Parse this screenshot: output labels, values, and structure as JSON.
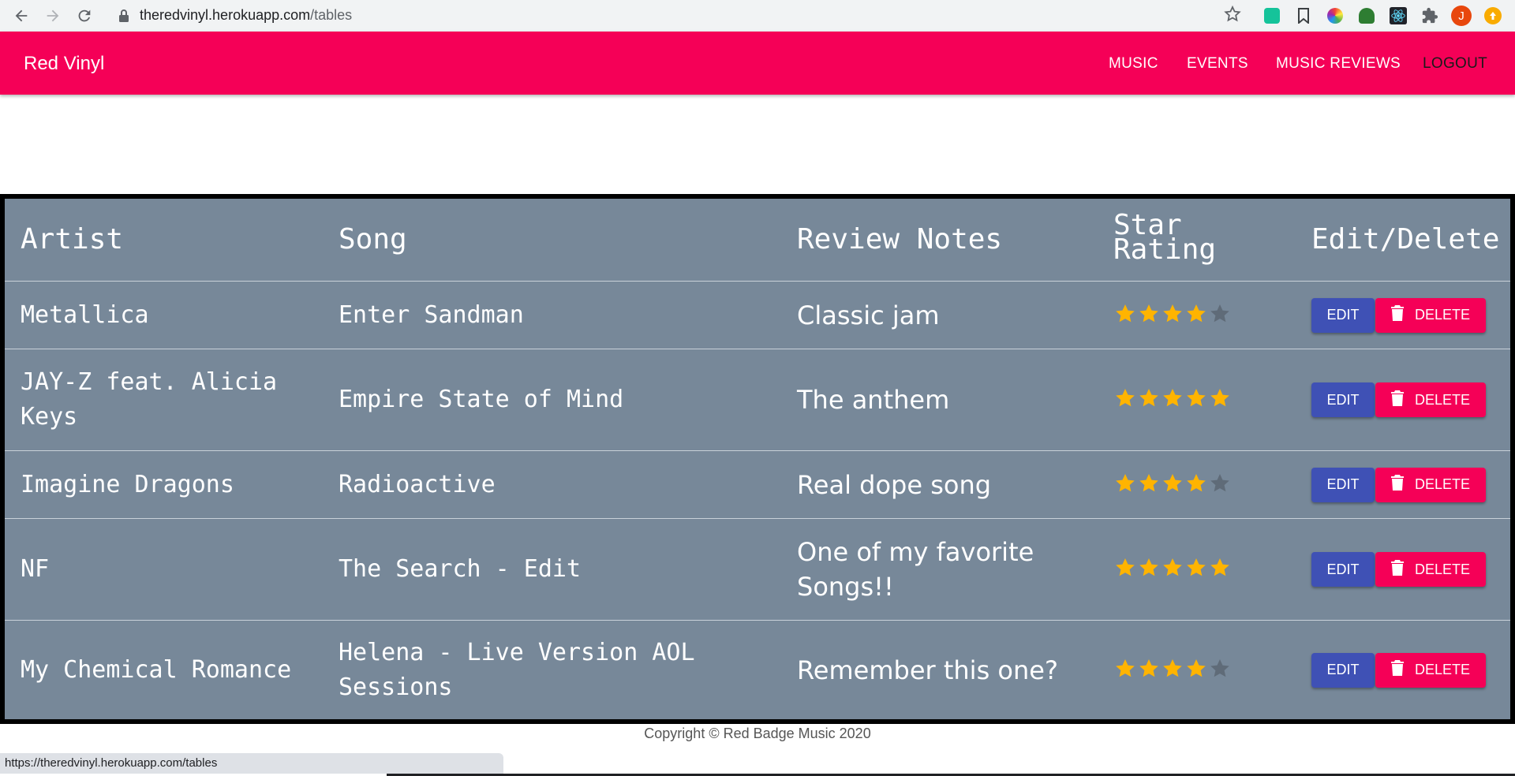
{
  "browser": {
    "url_host": "theredvinyl.herokuapp.com",
    "url_path": "/tables",
    "status_url": "https://theredvinyl.herokuapp.com/tables",
    "profile_initial": "J"
  },
  "appbar": {
    "brand": "Red Vinyl",
    "nav": {
      "music": "MUSIC",
      "events": "EVENTS",
      "reviews": "MUSIC REVIEWS",
      "logout": "LOGOUT"
    },
    "color": "#f50057"
  },
  "table": {
    "headers": {
      "artist": "Artist",
      "song": "Song",
      "notes": "Review Notes",
      "rating_line1": "Star",
      "rating_line2": "Rating",
      "actions": "Edit/Delete"
    },
    "rows": [
      {
        "artist_1": "Metallica",
        "artist_2": "",
        "song_1": "Enter Sandman",
        "song_2": "",
        "notes_1": "Classic jam",
        "notes_2": "",
        "rating": 4
      },
      {
        "artist_1": "JAY-Z feat. Alicia",
        "artist_2": "Keys",
        "song_1": "Empire State of Mind",
        "song_2": "",
        "notes_1": "The anthem",
        "notes_2": "",
        "rating": 5
      },
      {
        "artist_1": "Imagine Dragons",
        "artist_2": "",
        "song_1": "Radioactive",
        "song_2": "",
        "notes_1": "Real dope song",
        "notes_2": "",
        "rating": 4
      },
      {
        "artist_1": "NF",
        "artist_2": "",
        "song_1": "The Search - Edit",
        "song_2": "",
        "notes_1": "One of my favorite",
        "notes_2": "Songs!!",
        "rating": 5
      },
      {
        "artist_1": "My Chemical Romance",
        "artist_2": "",
        "song_1": "Helena - Live Version AOL",
        "song_2": "Sessions",
        "notes_1": "Remember this one?",
        "notes_2": "",
        "rating": 4
      }
    ],
    "max_rating": 5,
    "edit_label": "EDIT",
    "delete_label": "DELETE",
    "star_on_color": "#ffb400",
    "star_off_color": "#5f6b78"
  },
  "footer": {
    "copyright": "Copyright © Red Badge Music 2020"
  }
}
